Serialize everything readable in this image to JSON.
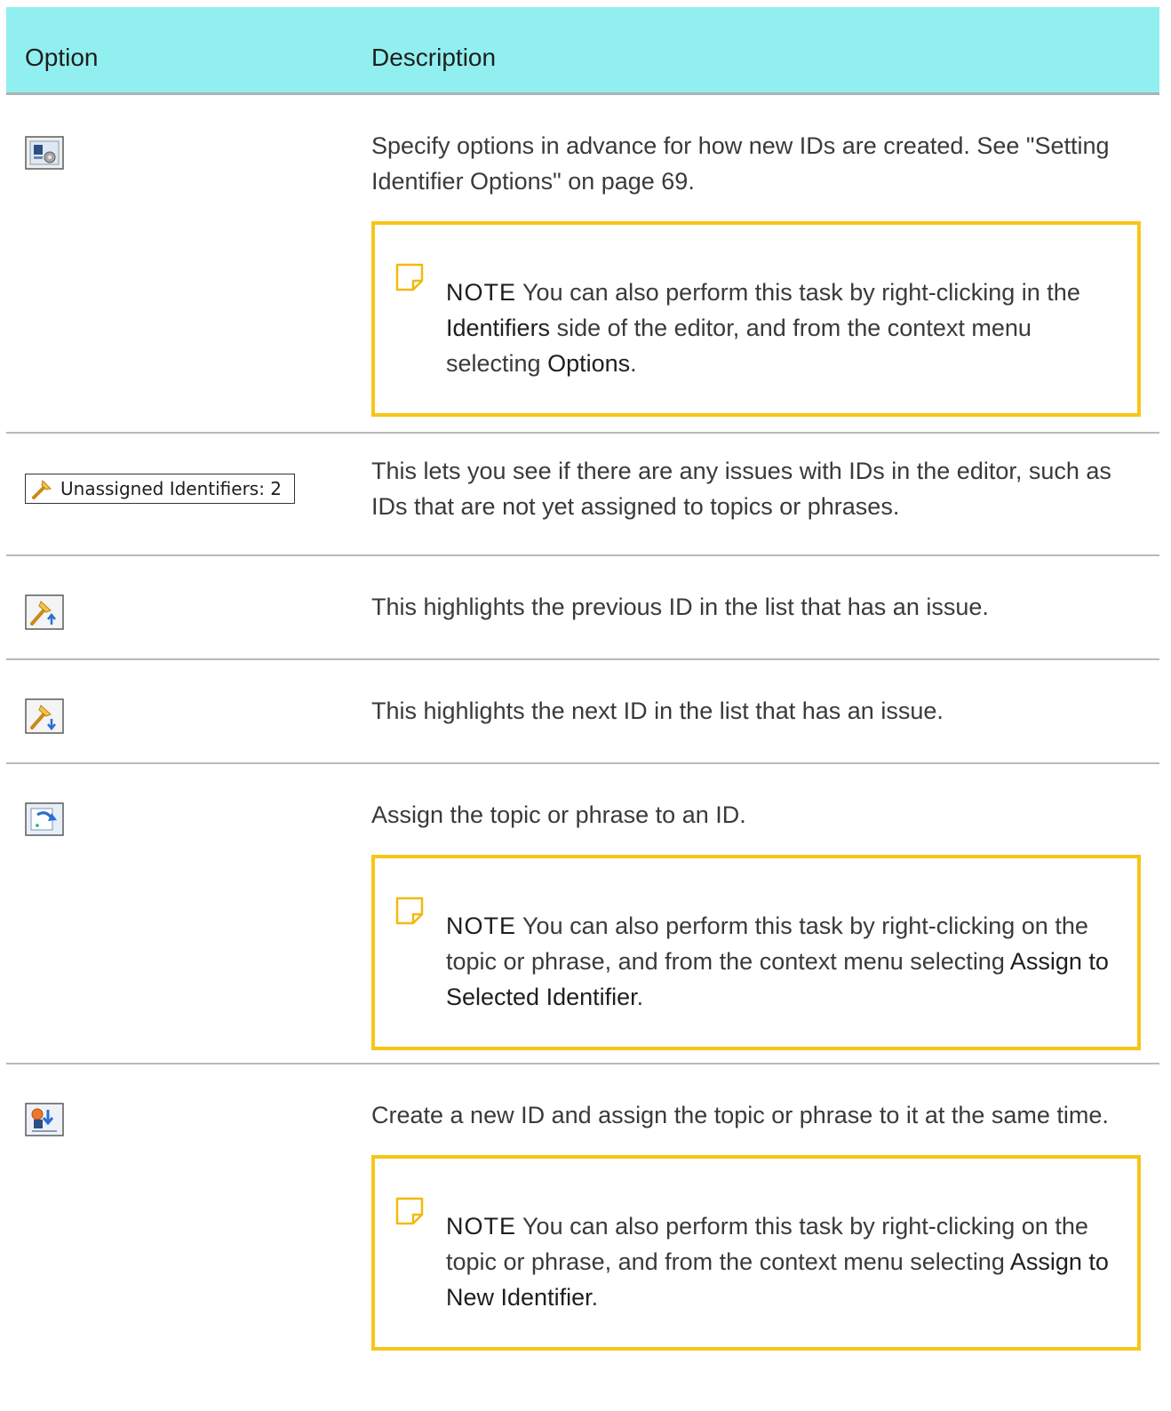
{
  "header": {
    "option": "Option",
    "description": "Description"
  },
  "rows": [
    {
      "icon": "identifier-options-icon",
      "description": "Specify options in advance for how new IDs are created. See \"Setting Identifier Options\" on page 69.",
      "note": {
        "label": "NOTE",
        "text_before": " You can also perform this task by right-clicking in the ",
        "emph1": "Identifiers",
        "text_middle": " side of the editor, and from the context menu selecting ",
        "emph2": "Options",
        "text_after": "."
      }
    },
    {
      "icon": "unassigned-identifiers-badge",
      "badge_text": "Unassigned Identifiers: 2",
      "description": "This lets you see if there are any issues with IDs in the editor, such as IDs that are not yet assigned to topics or phrases."
    },
    {
      "icon": "previous-issue-icon",
      "description": "This highlights the previous ID in the list that has an issue."
    },
    {
      "icon": "next-issue-icon",
      "description": "This highlights the next ID in the list that has an issue."
    },
    {
      "icon": "assign-identifier-icon",
      "description": "Assign the topic or phrase to an ID.",
      "note": {
        "label": "NOTE",
        "text_before": " You can also perform this task by right-clicking on the topic or phrase, and from the context menu selecting ",
        "emph1": "Assign to Selected Identifier",
        "text_after": "."
      }
    },
    {
      "icon": "assign-new-identifier-icon",
      "description": "Create a new ID and assign the topic or phrase to it at the same time.",
      "note": {
        "label": "NOTE",
        "text_before": " You can also perform this task by right-clicking on the topic or phrase, and from the context menu selecting ",
        "emph1": "Assign to New Identifier",
        "text_after": "."
      }
    }
  ],
  "colors": {
    "header_bg": "#92efef",
    "note_border": "#f6c516",
    "divider": "#b9b9b9"
  }
}
